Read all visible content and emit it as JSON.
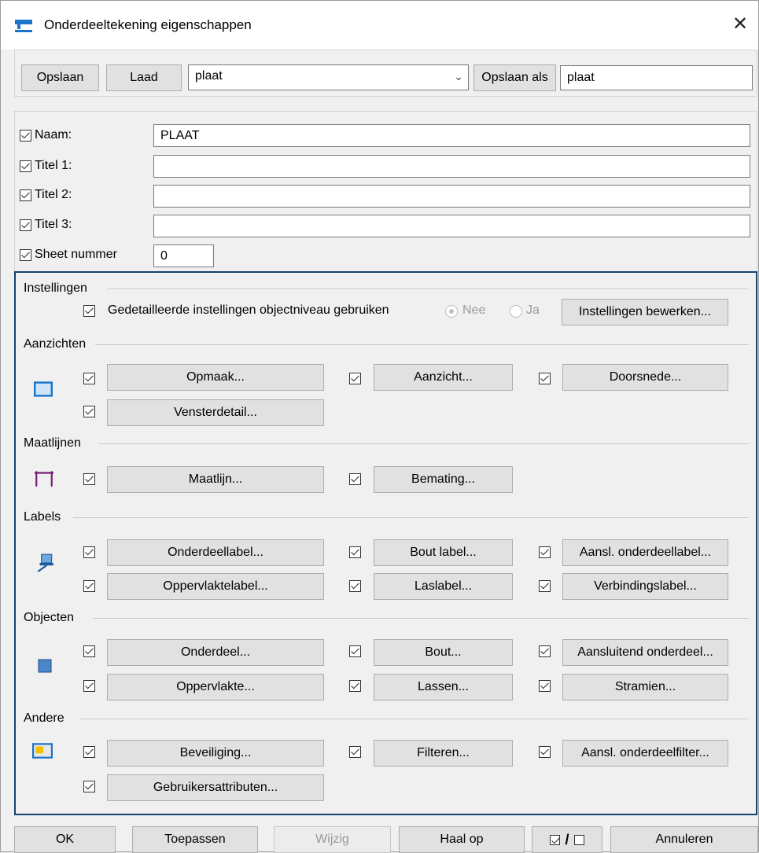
{
  "window": {
    "title": "Onderdeeltekening eigenschappen"
  },
  "toolbar": {
    "save_label": "Opslaan",
    "load_label": "Laad",
    "preset_value": "plaat",
    "save_as_label": "Opslaan als",
    "save_as_value": "plaat"
  },
  "fields": [
    {
      "label": "Naam:",
      "value": "PLAAT"
    },
    {
      "label": "Titel 1:",
      "value": ""
    },
    {
      "label": "Titel 2:",
      "value": ""
    },
    {
      "label": "Titel 3:",
      "value": ""
    },
    {
      "label": "Sheet nummer",
      "value": "0"
    }
  ],
  "instellingen": {
    "title": "Instellingen",
    "checkbox_label": "Gedetailleerde instellingen objectniveau gebruiken",
    "radio_nee": "Nee",
    "radio_ja": "Ja",
    "edit_button": "Instellingen bewerken..."
  },
  "aanzichten": {
    "title": "Aanzichten",
    "buttons": [
      "Opmaak...",
      "Aanzicht...",
      "Doorsnede...",
      "Vensterdetail..."
    ]
  },
  "maatlijnen": {
    "title": "Maatlijnen",
    "buttons": [
      "Maatlijn...",
      "Bemating..."
    ]
  },
  "labels": {
    "title": "Labels",
    "buttons": [
      "Onderdeellabel...",
      "Bout label...",
      "Aansl. onderdeellabel...",
      "Oppervlaktelabel...",
      "Laslabel...",
      "Verbindingslabel..."
    ]
  },
  "objecten": {
    "title": "Objecten",
    "buttons": [
      "Onderdeel...",
      "Bout...",
      "Aansluitend onderdeel...",
      "Oppervlakte...",
      "Lassen...",
      "Stramien..."
    ]
  },
  "andere": {
    "title": "Andere",
    "buttons": [
      "Beveiliging...",
      "Filteren...",
      "Aansl. onderdeelfilter...",
      "Gebruikersattributen..."
    ]
  },
  "footer": {
    "ok": "OK",
    "apply": "Toepassen",
    "modify": "Wijzig",
    "fetch": "Haal op",
    "toggle": "/",
    "cancel": "Annuleren"
  },
  "colors": {
    "frame": "#14426e",
    "accent": "#1a73c8"
  }
}
